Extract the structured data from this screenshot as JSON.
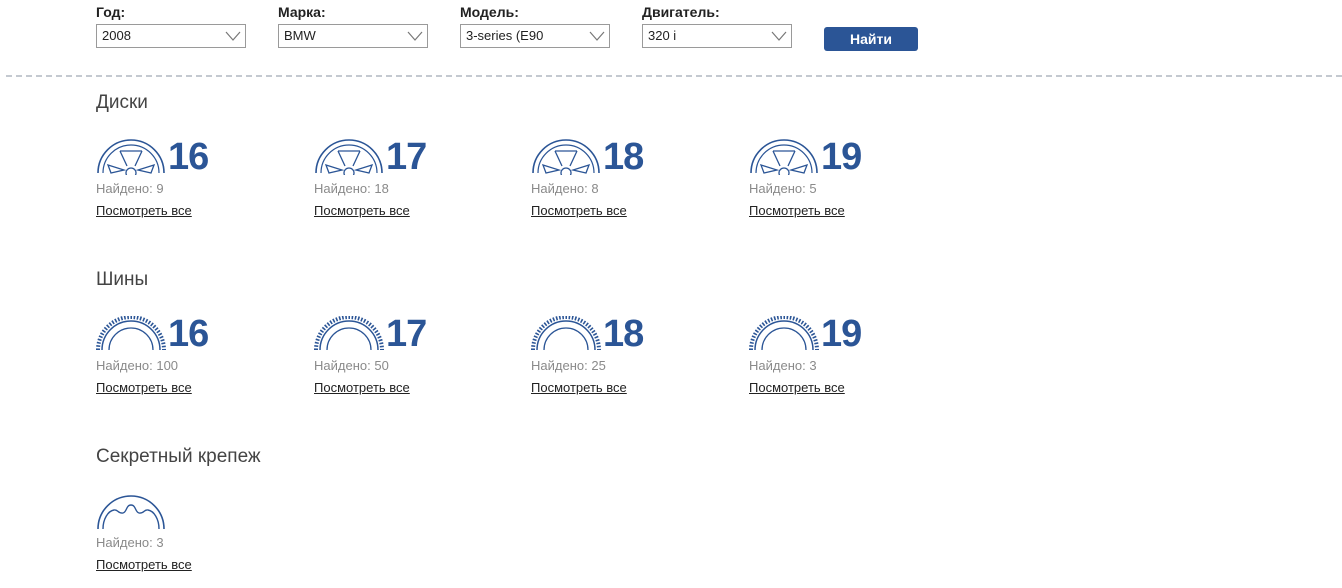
{
  "filters": {
    "year": {
      "label": "Год:",
      "value": "2008"
    },
    "brand": {
      "label": "Марка:",
      "value": "BMW"
    },
    "model": {
      "label": "Модель:",
      "value": "3-series (E90"
    },
    "engine": {
      "label": "Двигатель:",
      "value": "320 i"
    },
    "search_label": "Найти"
  },
  "found_prefix": "Найдено:",
  "view_all_label": "Посмотреть все",
  "colors": {
    "accent": "#2b5596",
    "muted": "#8a8a8a",
    "divider": "#c4c9d0"
  },
  "sections": {
    "rims": {
      "title": "Диски",
      "icon": "wheel-rim-icon",
      "items": [
        {
          "size": "16",
          "found": "9"
        },
        {
          "size": "17",
          "found": "18"
        },
        {
          "size": "18",
          "found": "8"
        },
        {
          "size": "19",
          "found": "5"
        }
      ]
    },
    "tires": {
      "title": "Шины",
      "icon": "tire-icon",
      "items": [
        {
          "size": "16",
          "found": "100"
        },
        {
          "size": "17",
          "found": "50"
        },
        {
          "size": "18",
          "found": "25"
        },
        {
          "size": "19",
          "found": "3"
        }
      ]
    },
    "locks": {
      "title": "Секретный крепеж",
      "icon": "lock-nut-icon",
      "items": [
        {
          "found": "3"
        }
      ]
    }
  }
}
